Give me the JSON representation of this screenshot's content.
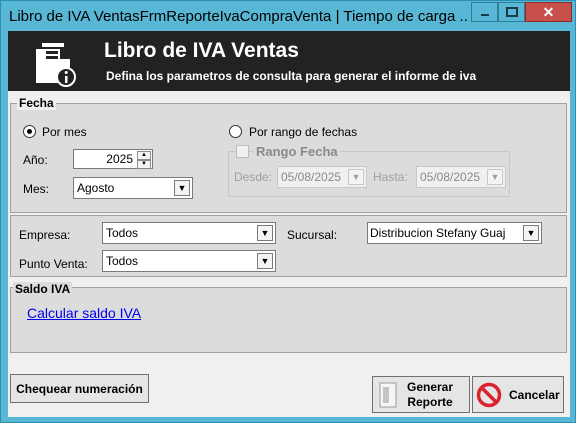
{
  "window": {
    "title": "Libro de IVA VentasFrmReporteIvaCompraVenta | Tiempo de carga ...",
    "close_symbol": "✕"
  },
  "header": {
    "title": "Libro de IVA Ventas",
    "subtitle": "Defina los parametros de consulta para generar el informe de iva",
    "icon": "document-info-icon"
  },
  "fecha": {
    "group_label": "Fecha",
    "radio_por_mes": "Por mes",
    "radio_por_rango": "Por rango de fechas",
    "anio_label": "Año:",
    "anio_value": "2025",
    "mes_label": "Mes:",
    "mes_value": "Agosto",
    "rango_fecha_label": "Rango Fecha",
    "desde_label": "Desde:",
    "desde_value": "05/08/2025",
    "hasta_label": "Hasta:",
    "hasta_value": "05/08/2025"
  },
  "filtros": {
    "empresa_label": "Empresa:",
    "empresa_value": "Todos",
    "sucursal_label": "Sucursal:",
    "sucursal_value": "Distribucion Stefany Guaj",
    "punto_venta_label": "Punto Venta:",
    "punto_venta_value": "Todos"
  },
  "saldo": {
    "group_label": "Saldo IVA",
    "link": "Calcular saldo IVA"
  },
  "buttons": {
    "chequear": "Chequear numeración",
    "generar_line1": "Generar",
    "generar_line2": "Reporte",
    "cancelar": "Cancelar"
  },
  "colors": {
    "title_bar": "#58b7d4",
    "header_bg": "#222222",
    "close_button": "#c7504a",
    "link": "#0000ee",
    "cancel_icon": "#d9232e"
  }
}
